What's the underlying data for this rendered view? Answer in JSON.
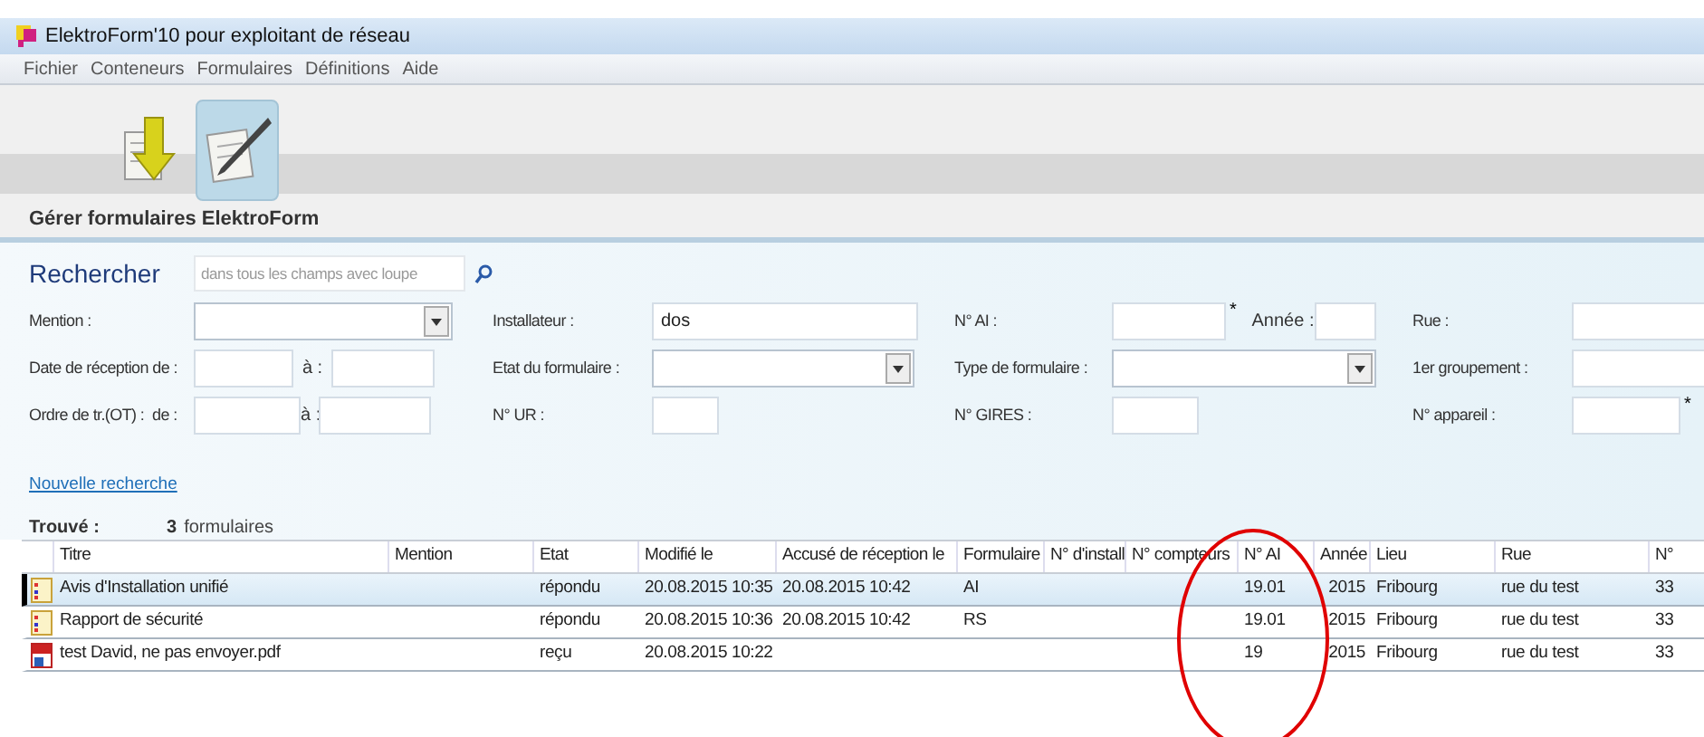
{
  "window": {
    "title": "ElektroForm'10 pour exploitant de réseau"
  },
  "menu": [
    "Fichier",
    "Conteneurs",
    "Formulaires",
    "Définitions",
    "Aide"
  ],
  "toolbar": [
    {
      "kind": "import",
      "selected": false
    },
    {
      "kind": "edit",
      "selected": true
    }
  ],
  "section_title": "Gérer formulaires ElektroForm",
  "search": {
    "title": "Rechercher",
    "placeholder": "dans tous les champs avec loupe",
    "rows": [
      [
        {
          "label": "Mention :",
          "controls": [
            {
              "kind": "select"
            }
          ]
        },
        {
          "label": "Installateur :",
          "controls": [
            {
              "kind": "text",
              "value": "dos"
            }
          ]
        },
        {
          "label": "N° AI :",
          "controls": [
            {
              "kind": "text"
            },
            {
              "kind": "star",
              "text": "*"
            },
            {
              "kind": "label",
              "text": "Année :"
            },
            {
              "kind": "text"
            }
          ]
        },
        {
          "label": "Rue :",
          "controls": [
            {
              "kind": "text"
            }
          ]
        }
      ],
      [
        {
          "label": "Date de réception de :",
          "controls": [
            {
              "kind": "text"
            },
            {
              "kind": "label",
              "text": "à :"
            },
            {
              "kind": "text"
            }
          ]
        },
        {
          "label": "Etat du formulaire :",
          "controls": [
            {
              "kind": "select"
            }
          ]
        },
        {
          "label": "Type de formulaire :",
          "controls": [
            {
              "kind": "select"
            }
          ]
        },
        {
          "label": "1er groupement :",
          "controls": [
            {
              "kind": "text"
            }
          ]
        }
      ],
      [
        {
          "label": "Ordre de tr.(OT) :  de :",
          "controls": [
            {
              "kind": "text"
            },
            {
              "kind": "label",
              "text": "à :"
            },
            {
              "kind": "text"
            }
          ]
        },
        {
          "label": "N° UR :",
          "controls": [
            {
              "kind": "text"
            }
          ]
        },
        {
          "label": "N° GIRES :",
          "controls": [
            {
              "kind": "text"
            }
          ]
        },
        {
          "label": "N° appareil :",
          "controls": [
            {
              "kind": "text"
            },
            {
              "kind": "star",
              "text": "*"
            }
          ]
        }
      ]
    ],
    "link": "Nouvelle recherche",
    "found_label": "Trouvé :",
    "found_count": "3",
    "found_unit": "formulaires"
  },
  "table": {
    "columns": [
      "Titre",
      "Mention",
      "Etat",
      "Modifié le",
      "Accusé de réception le",
      "Formulaire",
      "N° d'install",
      "N° compteurs",
      "N° AI",
      "Année",
      "Lieu",
      "Rue",
      "N°"
    ],
    "rows": [
      {
        "kind": "form",
        "selected": true,
        "cells": [
          "Avis d'Installation unifié",
          "",
          "répondu",
          "20.08.2015 10:35",
          "20.08.2015 10:42",
          "AI",
          "",
          "",
          "19.01",
          "2015",
          "Fribourg",
          "rue du test",
          "33"
        ]
      },
      {
        "kind": "form",
        "selected": false,
        "cells": [
          "Rapport de sécurité",
          "",
          "répondu",
          "20.08.2015 10:36",
          "20.08.2015 10:42",
          "RS",
          "",
          "",
          "19.01",
          "2015",
          "Fribourg",
          "rue du test",
          "33"
        ]
      },
      {
        "kind": "pdf",
        "selected": false,
        "cells": [
          "test David, ne pas envoyer.pdf",
          "",
          "reçu",
          "20.08.2015 10:22",
          "",
          "",
          "",
          "",
          "19",
          "2015",
          "Fribourg",
          "rue du test",
          "33"
        ]
      }
    ]
  }
}
